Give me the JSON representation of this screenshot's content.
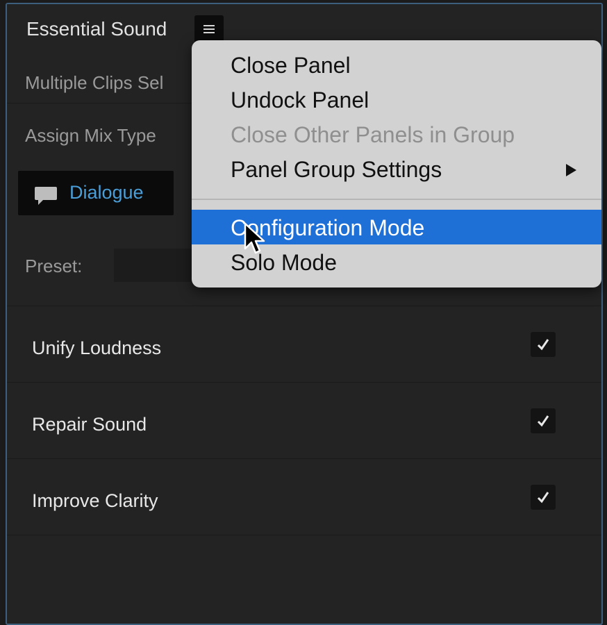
{
  "panel": {
    "title": "Essential Sound",
    "menu_icon": "hamburger-icon"
  },
  "rows": {
    "selection_label": "Multiple Clips Sel",
    "assign_label": "Assign Mix Type",
    "dialogue_label": "Dialogue",
    "dialogue_icon": "speech-bubble-icon",
    "preset_label": "Preset:"
  },
  "options": [
    {
      "label": "Unify Loudness",
      "checked": true
    },
    {
      "label": "Repair Sound",
      "checked": true
    },
    {
      "label": "Improve Clarity",
      "checked": true
    }
  ],
  "menu": {
    "items": [
      {
        "label": "Close Panel",
        "enabled": true
      },
      {
        "label": "Undock Panel",
        "enabled": true
      },
      {
        "label": "Close Other Panels in Group",
        "enabled": false
      },
      {
        "label": "Panel Group Settings",
        "enabled": true,
        "submenu": true
      },
      {
        "label": "Configuration Mode",
        "enabled": true,
        "highlighted": true
      },
      {
        "label": "Solo Mode",
        "enabled": true
      }
    ]
  },
  "colors": {
    "accent": "#1e6fd6",
    "dialogue": "#4a9ed8",
    "panel_border": "#3d5f7e"
  }
}
